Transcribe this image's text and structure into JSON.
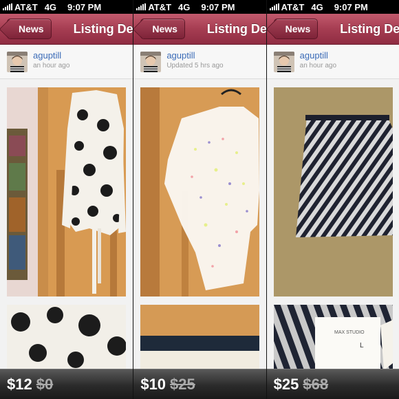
{
  "status_bar": {
    "carrier": "AT&T",
    "network": "4G",
    "time": "9:07 PM"
  },
  "nav": {
    "back_label": "News",
    "title": "Listing Details"
  },
  "panels": [
    {
      "user": {
        "name": "aguptill",
        "time": "an hour ago"
      },
      "price": {
        "current": "$12",
        "original": "$0"
      }
    },
    {
      "user": {
        "name": "aguptill",
        "time": "Updated 5 hrs ago"
      },
      "price": {
        "current": "$10",
        "original": "$25"
      }
    },
    {
      "user": {
        "name": "aguptill",
        "time": "an hour ago"
      },
      "price": {
        "current": "$25",
        "original": "$68"
      },
      "tag_text": {
        "brand": "MAX STUDIO",
        "size": "L"
      }
    }
  ],
  "colors": {
    "nav": "#a63d52",
    "username": "#3a6bb7",
    "price_bar": "#2b2b2b"
  }
}
